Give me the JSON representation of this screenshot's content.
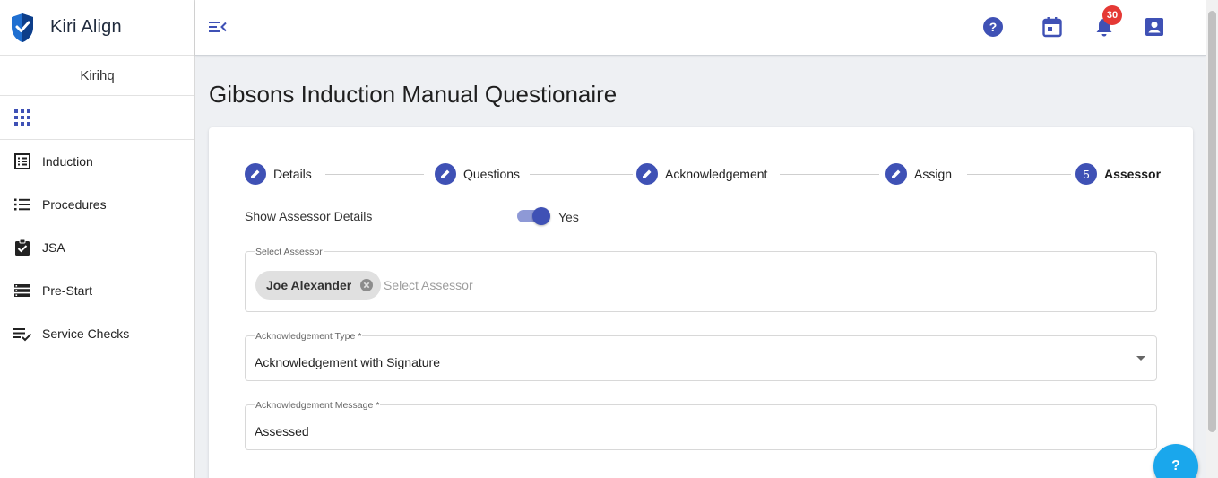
{
  "app": {
    "title": "Kiri Align",
    "organization": "Kirihq",
    "brand_color": "#1f6fd1",
    "accent_color": "#3f51b5"
  },
  "sidebar": {
    "apps_icon": "apps-grid-icon",
    "items": [
      {
        "label": "Induction",
        "icon": "list-alt-icon"
      },
      {
        "label": "Procedures",
        "icon": "format-list-icon"
      },
      {
        "label": "JSA",
        "icon": "assignment-turned-in-icon"
      },
      {
        "label": "Pre-Start",
        "icon": "storage-icon"
      },
      {
        "label": "Service Checks",
        "icon": "playlist-add-check-icon"
      }
    ]
  },
  "topbar": {
    "menu_icon": "menu-open-icon",
    "icons": [
      "help-icon",
      "calendar-icon",
      "notifications-icon",
      "account-box-icon"
    ],
    "notification_count": "30"
  },
  "page": {
    "title": "Gibsons Induction Manual Questionaire"
  },
  "stepper": {
    "steps": [
      {
        "label": "Details",
        "state": "edited",
        "icon": "pencil-icon"
      },
      {
        "label": "Questions",
        "state": "edited",
        "icon": "pencil-icon"
      },
      {
        "label": "Acknowledgement",
        "state": "edited",
        "icon": "pencil-icon"
      },
      {
        "label": "Assign",
        "state": "edited",
        "icon": "pencil-icon"
      },
      {
        "label": "Assessor",
        "state": "active",
        "number": "5"
      }
    ]
  },
  "form": {
    "show_assessor": {
      "label": "Show Assessor Details",
      "value": "Yes",
      "checked": true
    },
    "select_assessor": {
      "label": "Select Assessor",
      "chips": [
        "Joe Alexander"
      ],
      "placeholder": "Select Assessor"
    },
    "ack_type": {
      "label": "Acknowledgement Type *",
      "value": "Acknowledgement with Signature"
    },
    "ack_message": {
      "label": "Acknowledgement Message *",
      "value": "Assessed"
    }
  },
  "help_fab": {
    "label": "?"
  }
}
